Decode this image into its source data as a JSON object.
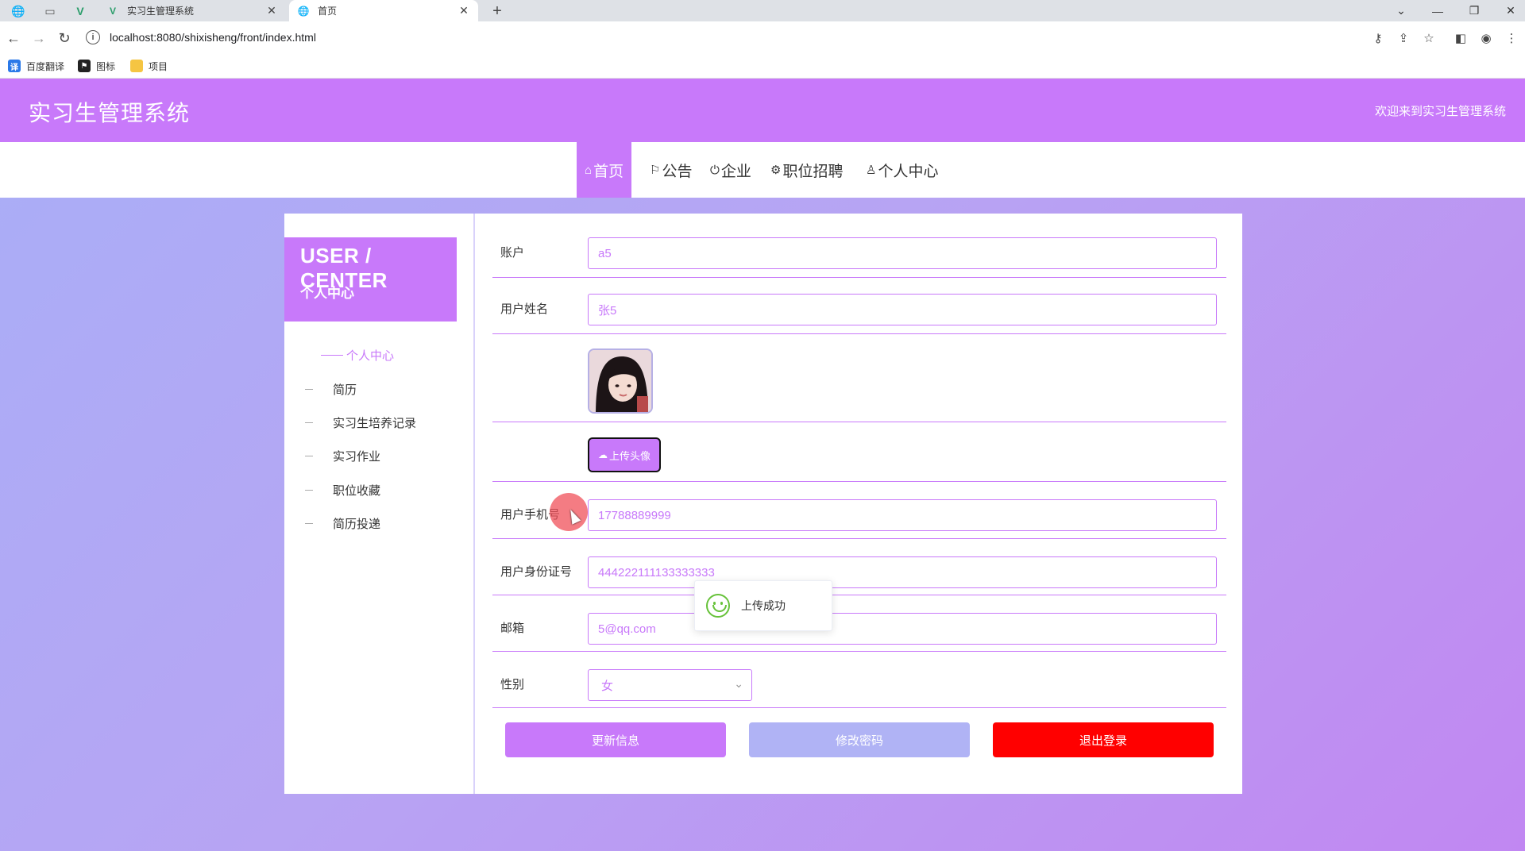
{
  "browser": {
    "tabs": [
      {
        "title": "实习生管理系统",
        "active": false
      },
      {
        "title": "首页",
        "active": true
      }
    ],
    "url": "localhost:8080/shixisheng/front/index.html",
    "bookmarks": [
      "百度翻译",
      "图标",
      "项目"
    ]
  },
  "header": {
    "title": "实习生管理系统",
    "welcome": "欢迎来到实习生管理系统"
  },
  "nav": {
    "items": [
      {
        "icon": "⌂",
        "label": "首页",
        "active": true
      },
      {
        "icon": "⚐",
        "label": "公告"
      },
      {
        "icon": "⏻",
        "label": "企业"
      },
      {
        "icon": "⚙",
        "label": "职位招聘"
      },
      {
        "icon": "♙",
        "label": "个人中心"
      }
    ]
  },
  "sidebar": {
    "title_en": "USER / CENTER",
    "title_cn": "个人中心",
    "items": [
      "个人中心",
      "简历",
      "实习生培养记录",
      "实习作业",
      "职位收藏",
      "简历投递"
    ]
  },
  "form": {
    "account": {
      "label": "账户",
      "value": "a5"
    },
    "name": {
      "label": "用户姓名",
      "value": "张5"
    },
    "upload_label": "上传头像",
    "phone": {
      "label": "用户手机号",
      "value": "17788889999"
    },
    "id_card": {
      "label": "用户身份证号",
      "value": "444222111133333333"
    },
    "email": {
      "label": "邮箱",
      "value": "5@qq.com"
    },
    "gender": {
      "label": "性别",
      "value": "女"
    }
  },
  "buttons": {
    "update": "更新信息",
    "change_password": "修改密码",
    "logout": "退出登录"
  },
  "toast": {
    "message": "上传成功"
  },
  "colors": {
    "primary": "#c879fa",
    "secondary": "#b0b3f5",
    "danger": "#ff0000",
    "success": "#67c23a"
  }
}
